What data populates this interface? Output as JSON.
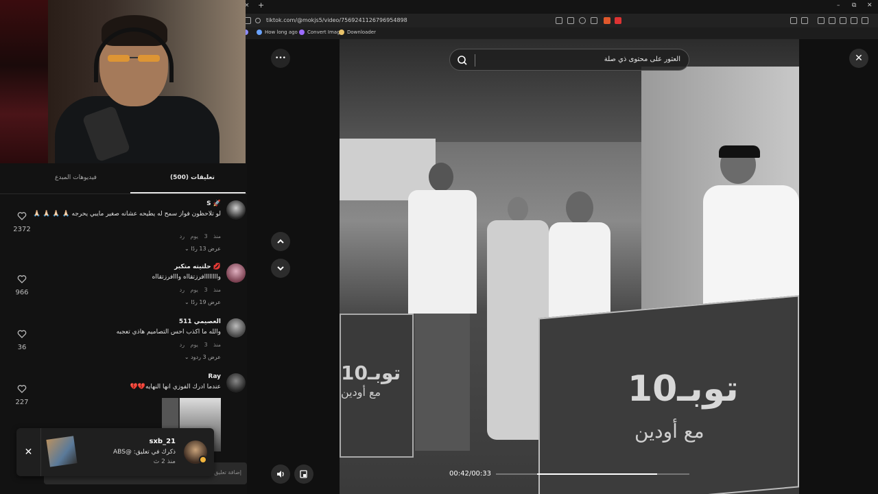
{
  "browser": {
    "tab_close": "×",
    "new_tab": "+",
    "url": "tiktok.com/@mokjs5/video/7569241126796954898",
    "bookmarks": [
      "How long ago",
      "Convert Image",
      "Downloader"
    ],
    "window_controls": [
      "–",
      "⧉",
      "✕"
    ]
  },
  "panel": {
    "tabs": {
      "comments": "(500) تعليقات",
      "creator_videos": "فيديوهات المبدع"
    },
    "comments": [
      {
        "name": "🚀 S",
        "text": "لو تلاحظون فواز سمح له يطيحه عشانه صغير مايبي يحرجه 🙏🏻 🙏🏻 🙏🏻 🙏🏻",
        "meta": "منذ 3 يوم  رد",
        "replies": "عرض 13 ردًا",
        "likes": "2372"
      },
      {
        "name": "💋 حلتيته متكبر",
        "text": "واااااااافرزتقااه وااافرزتقااه",
        "meta": "منذ 3 يوم  رد",
        "replies": "عرض 19 ردًا",
        "likes": "966"
      },
      {
        "name": "العصيمي 511",
        "text": "والله ما اكذب احس التصاميم هاذي تعجبه",
        "meta": "منذ 3 يوم  رد",
        "replies": "عرض 3 ردود",
        "likes": "36"
      },
      {
        "name": "Ray",
        "text": "عندما ادرك الفوزي انها النهايه💔💔",
        "meta": "",
        "replies": "",
        "likes": "227"
      }
    ],
    "input_placeholder": "إضافة تعليق..."
  },
  "toast": {
    "close": "✕",
    "user": "sxb_21",
    "message": "ذكرك في تعليق: @ABS",
    "time": "منذ 2 ث"
  },
  "viewer": {
    "search_placeholder": "العثور على محتوى ذي صلة",
    "close": "✕",
    "more": "•••",
    "time": "00:42/00:33",
    "progress": 0.79,
    "booth_text": "توبـ10",
    "booth_sub": "مع أودين",
    "booth_left_text": "توبـ10",
    "booth_left_sub": "مع أودين"
  }
}
